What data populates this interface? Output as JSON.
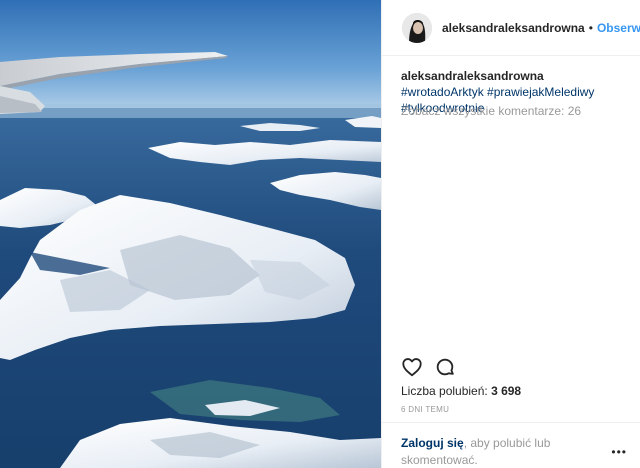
{
  "post": {
    "photo_alt": "aerial view of snow-covered islands"
  },
  "header": {
    "username": "aleksandraleksandrowna",
    "separator": "•",
    "follow_label": "Obserwuj"
  },
  "caption": {
    "username": "aleksandraleksandrowna",
    "hashtags": [
      "#wrotadoArktyk",
      "#prawiejakMelediwy",
      "#tylkoodwrotnie"
    ]
  },
  "comments": {
    "view_all_label": "Zobacz wszystkie komentarze: 26"
  },
  "actions": {
    "like_icon": "heart-icon",
    "comment_icon": "comment-icon"
  },
  "likes": {
    "label": "Liczba polubień:",
    "count": "3 698"
  },
  "timestamp": "6 DNI TEMU",
  "footer": {
    "login_label": "Zaloguj się",
    "rest_text": ", aby polubić lub skomentować.",
    "more_label": "•••"
  },
  "colors": {
    "link_blue": "#3897f0",
    "hashtag_blue": "#003569",
    "muted": "#999999",
    "text": "#262626"
  }
}
